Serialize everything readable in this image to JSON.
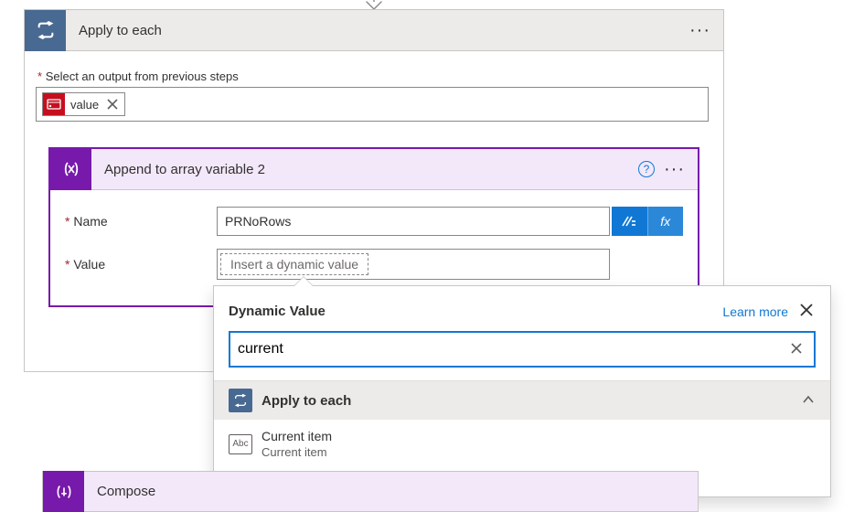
{
  "arrow": "down",
  "applyToEach": {
    "title": "Apply to each",
    "selectLabel": "Select an output from previous steps",
    "valueChip": "value"
  },
  "appendAction": {
    "title": "Append to array variable 2",
    "nameLabel": "Name",
    "nameValue": "PRNoRows",
    "valueLabel": "Value",
    "valuePlaceholder": "Insert a dynamic value"
  },
  "popover": {
    "title": "Dynamic Value",
    "learnMore": "Learn more",
    "searchValue": "current",
    "section": {
      "title": "Apply to each"
    },
    "item": {
      "primary": "Current item",
      "secondary": "Current item"
    }
  },
  "compose": {
    "title": "Compose"
  },
  "fxLabel": "fx"
}
